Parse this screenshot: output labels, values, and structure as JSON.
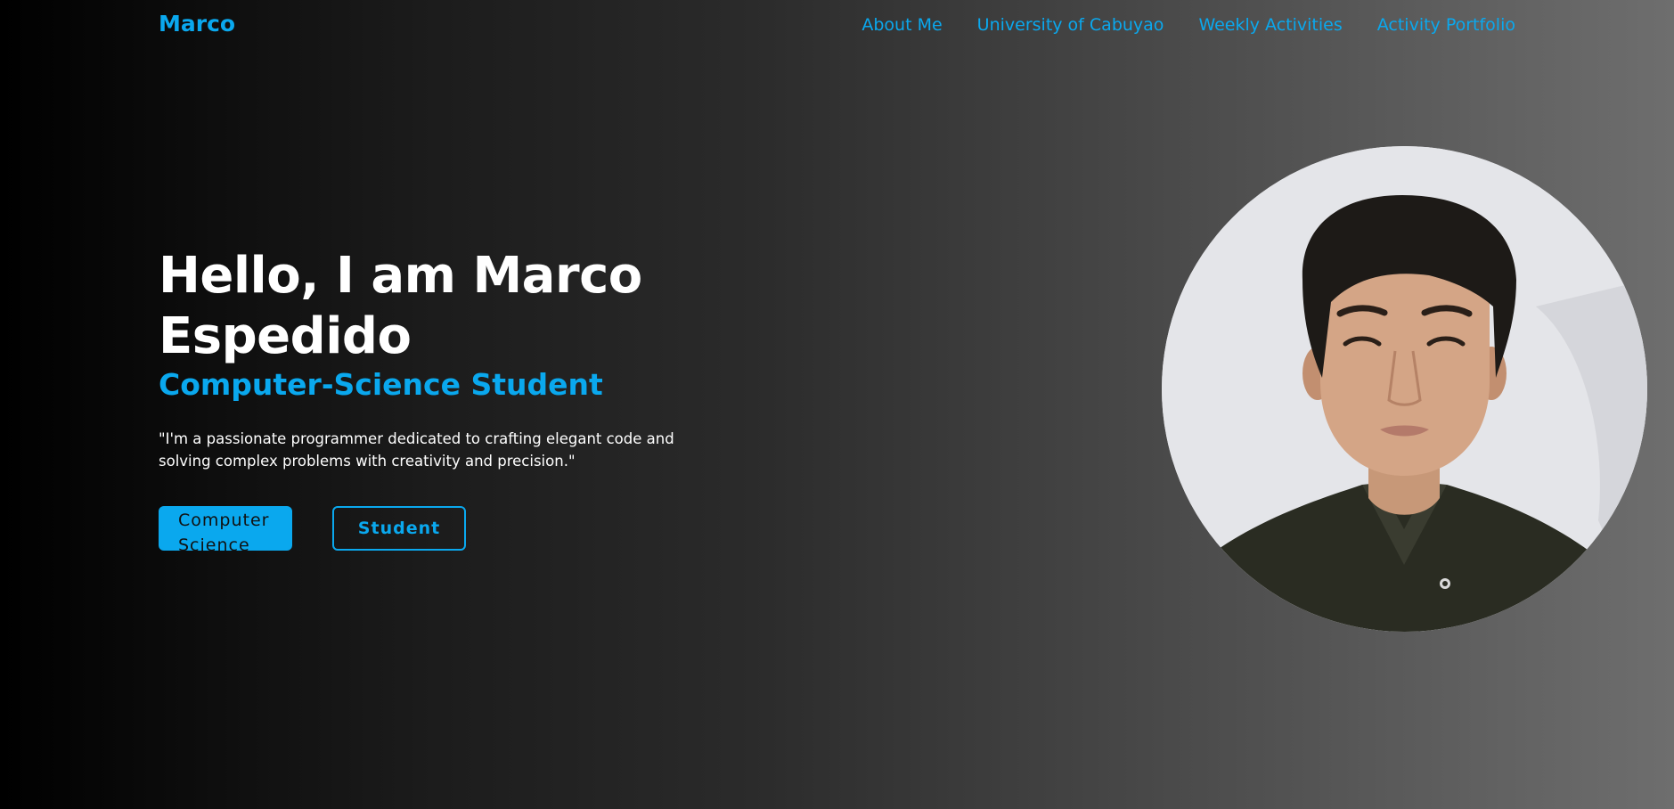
{
  "nav": {
    "logo": "Marco",
    "links": [
      {
        "label": "About Me"
      },
      {
        "label": "University of Cabuyao"
      },
      {
        "label": "Weekly Activities"
      },
      {
        "label": "Activity Portfolio"
      }
    ]
  },
  "hero": {
    "title": "Hello, I am Marco Espedido",
    "subtitle": "Computer-Science Student",
    "quote": "\"I'm a passionate programmer dedicated to crafting elegant code and solving complex problems with creativity and precision.\"",
    "buttons": {
      "primary": "Computer Science",
      "secondary": "Student"
    }
  },
  "colors": {
    "accent": "#0aa8ee",
    "text": "#ffffff"
  }
}
